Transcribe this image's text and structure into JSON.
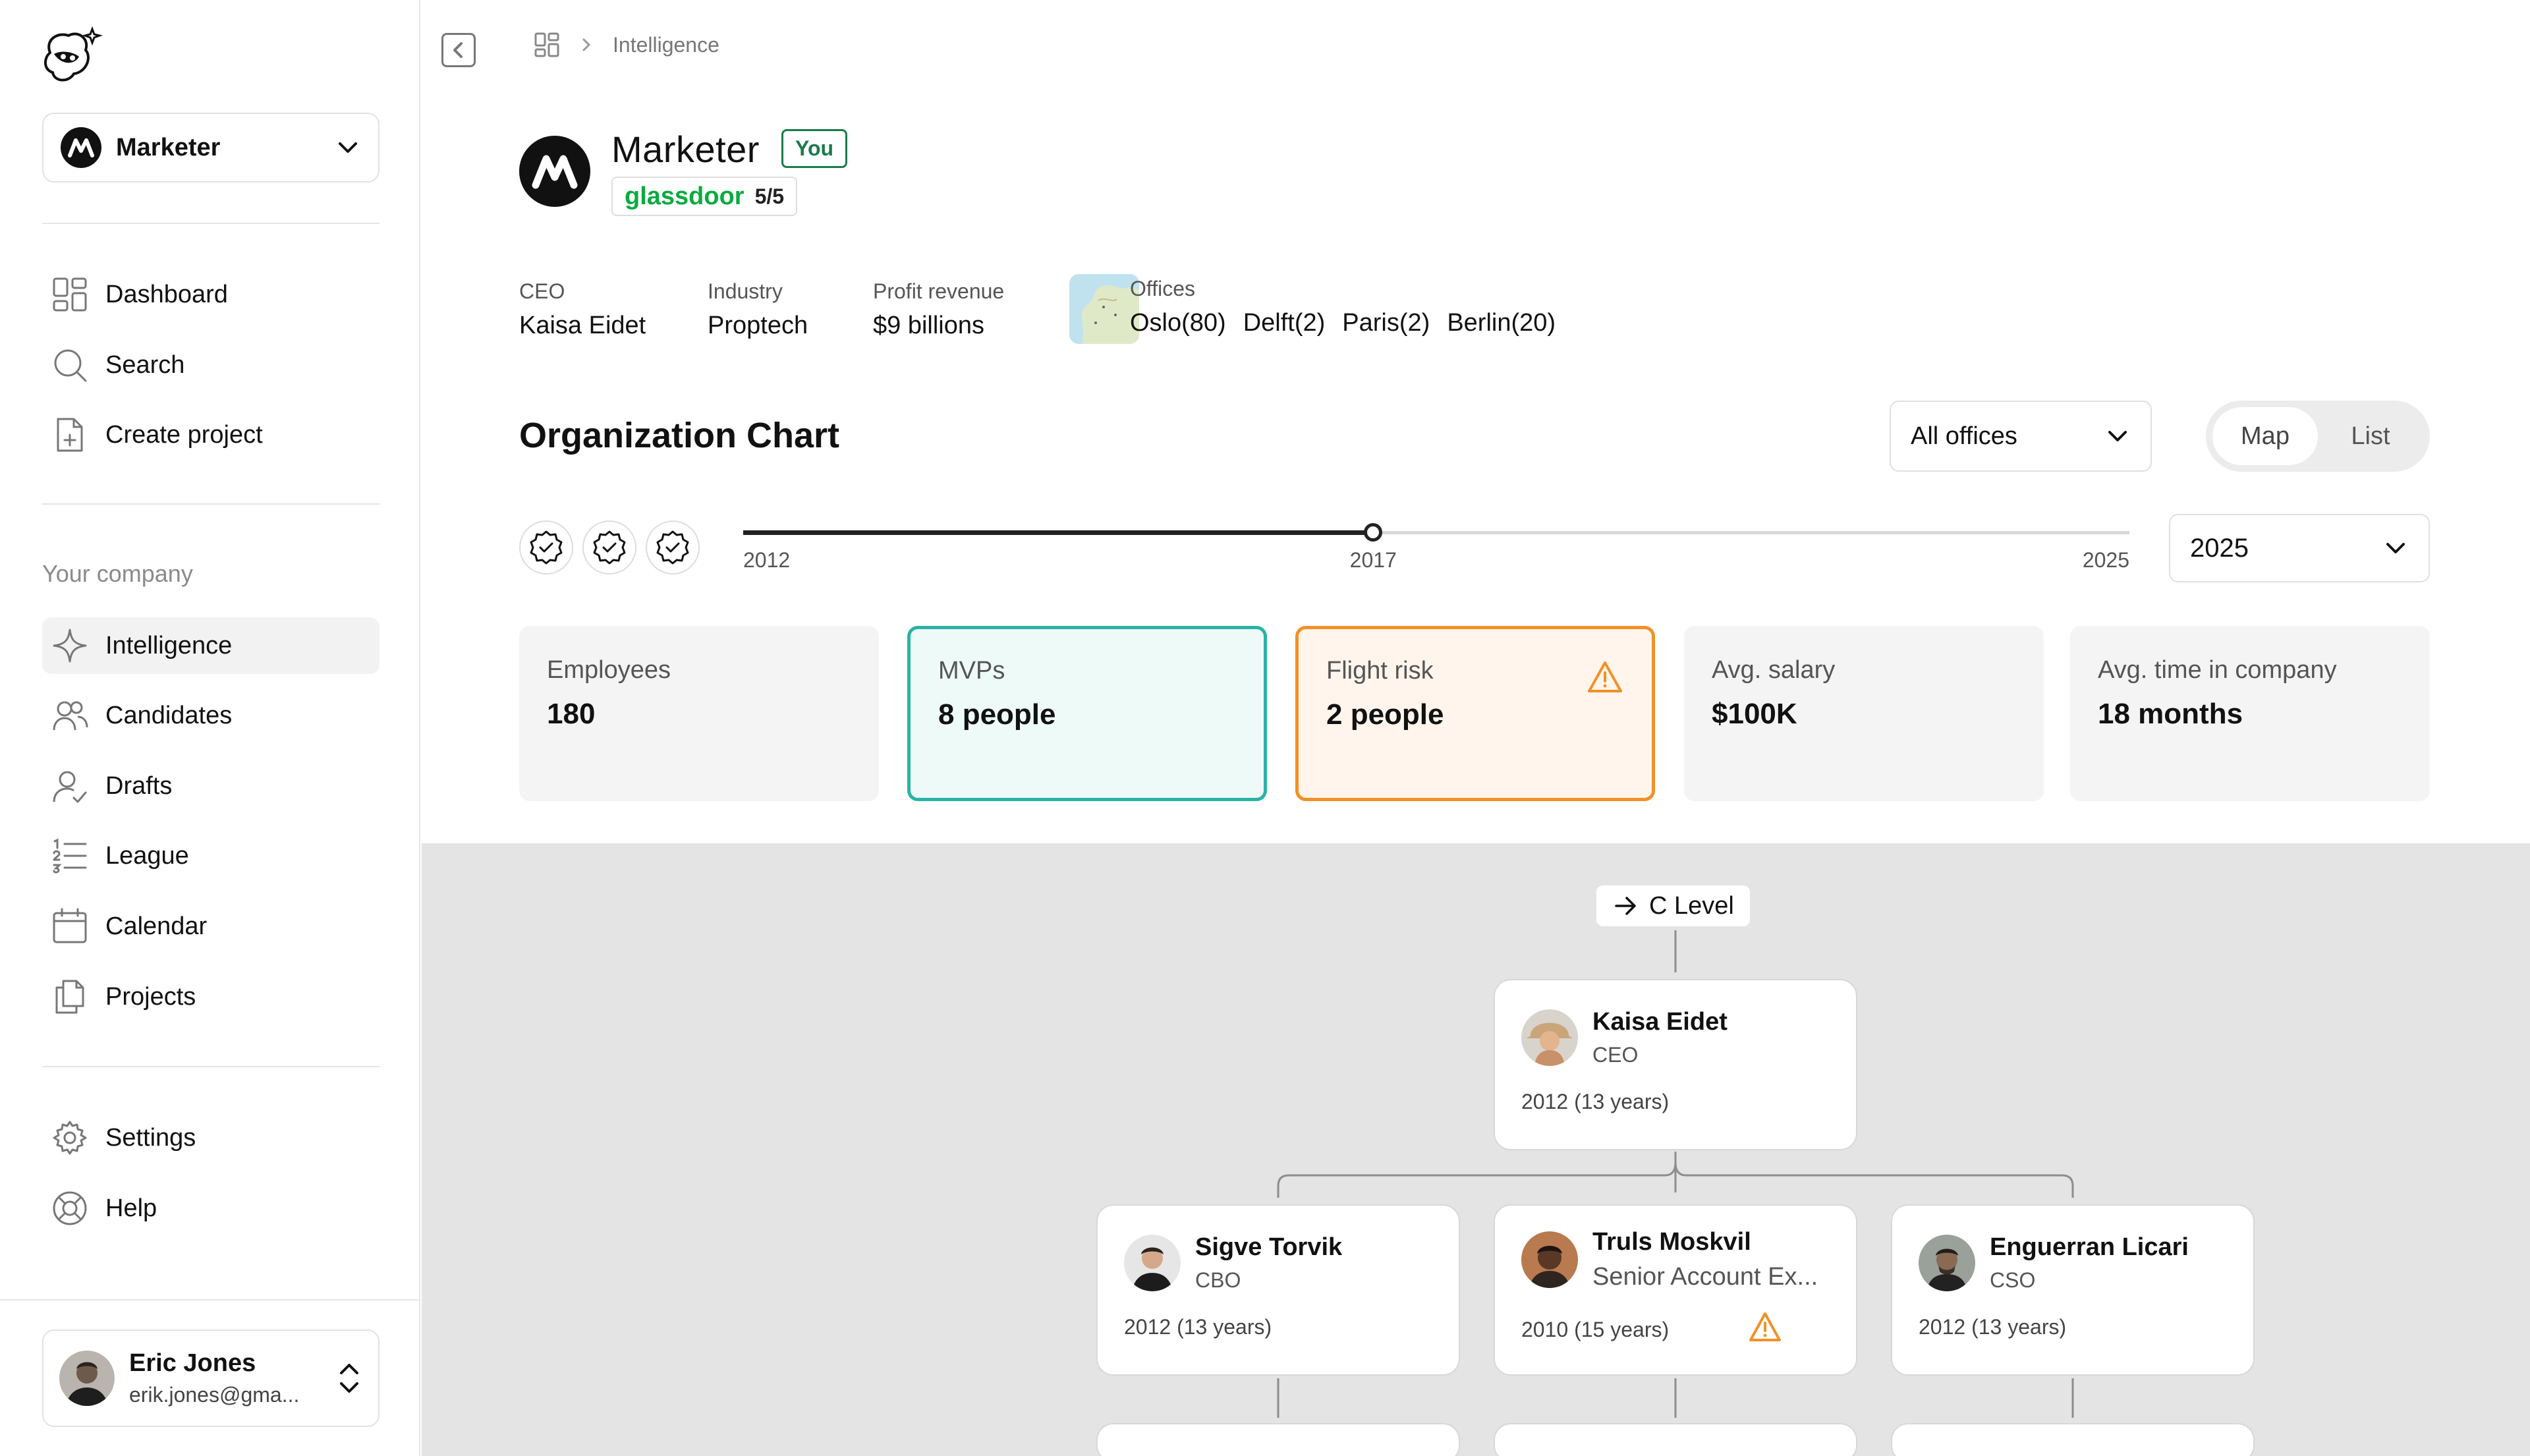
{
  "workspace": {
    "name": "Marketer"
  },
  "sidebar": {
    "main_items": [
      {
        "label": "Dashboard",
        "icon": "dashboard-icon"
      },
      {
        "label": "Search",
        "icon": "search-icon"
      },
      {
        "label": "Create project",
        "icon": "create-project-icon"
      }
    ],
    "section_label": "Your company",
    "company_items": [
      {
        "label": "Intelligence",
        "icon": "sparkle-icon",
        "active": true
      },
      {
        "label": "Candidates",
        "icon": "users-icon"
      },
      {
        "label": "Drafts",
        "icon": "user-check-icon"
      },
      {
        "label": "League",
        "icon": "list-ordered-icon"
      },
      {
        "label": "Calendar",
        "icon": "calendar-icon"
      },
      {
        "label": "Projects",
        "icon": "copy-icon"
      }
    ],
    "bottom_items": [
      {
        "label": "Settings",
        "icon": "gear-icon"
      },
      {
        "label": "Help",
        "icon": "lifebuoy-icon"
      }
    ],
    "user": {
      "name": "Eric Jones",
      "email": "erik.jones@gma..."
    }
  },
  "breadcrumb": {
    "current": "Intelligence"
  },
  "company": {
    "name": "Marketer",
    "you_badge": "You",
    "glassdoor_brand": "glassdoor",
    "glassdoor_score": "5/5",
    "ceo_label": "CEO",
    "ceo": "Kaisa Eidet",
    "industry_label": "Industry",
    "industry": "Proptech",
    "revenue_label": "Profit revenue",
    "revenue": "$9 billions",
    "offices_label": "Offices",
    "offices": [
      "Oslo(80)",
      "Delft(2)",
      "Paris(2)",
      "Berlin(20)"
    ]
  },
  "org_chart": {
    "title": "Organization Chart",
    "office_filter": "All offices",
    "view_options": [
      "Map",
      "List"
    ],
    "active_view": "Map",
    "timeline": {
      "start": "2012",
      "current": "2017",
      "end": "2025",
      "position": 0.4545
    },
    "year": "2025",
    "level_tag": "C Level"
  },
  "stats": [
    {
      "label": "Employees",
      "value": "180"
    },
    {
      "label": "MVPs",
      "value": "8 people"
    },
    {
      "label": "Flight risk",
      "value": "2 people"
    },
    {
      "label": "Avg. salary",
      "value": "$100K"
    },
    {
      "label": "Avg. time in company",
      "value": "18 months"
    }
  ],
  "nodes": [
    {
      "name": "Kaisa Eidet",
      "role": "CEO",
      "tenure": "2012 (13 years)"
    },
    {
      "name": "Sigve Torvik",
      "role": "CBO",
      "tenure": "2012 (13 years)"
    },
    {
      "name": "Truls Moskvil",
      "role": "Senior Account Ex...",
      "tenure": "2010 (15 years)",
      "flight_risk": true
    },
    {
      "name": "Enguerran Licari",
      "role": "CSO",
      "tenure": "2012 (13 years)"
    }
  ],
  "colors": {
    "mvp": "#2ab3a5",
    "risk": "#f19127",
    "glassdoor": "#0caa41",
    "you": "#1c7a4a"
  }
}
